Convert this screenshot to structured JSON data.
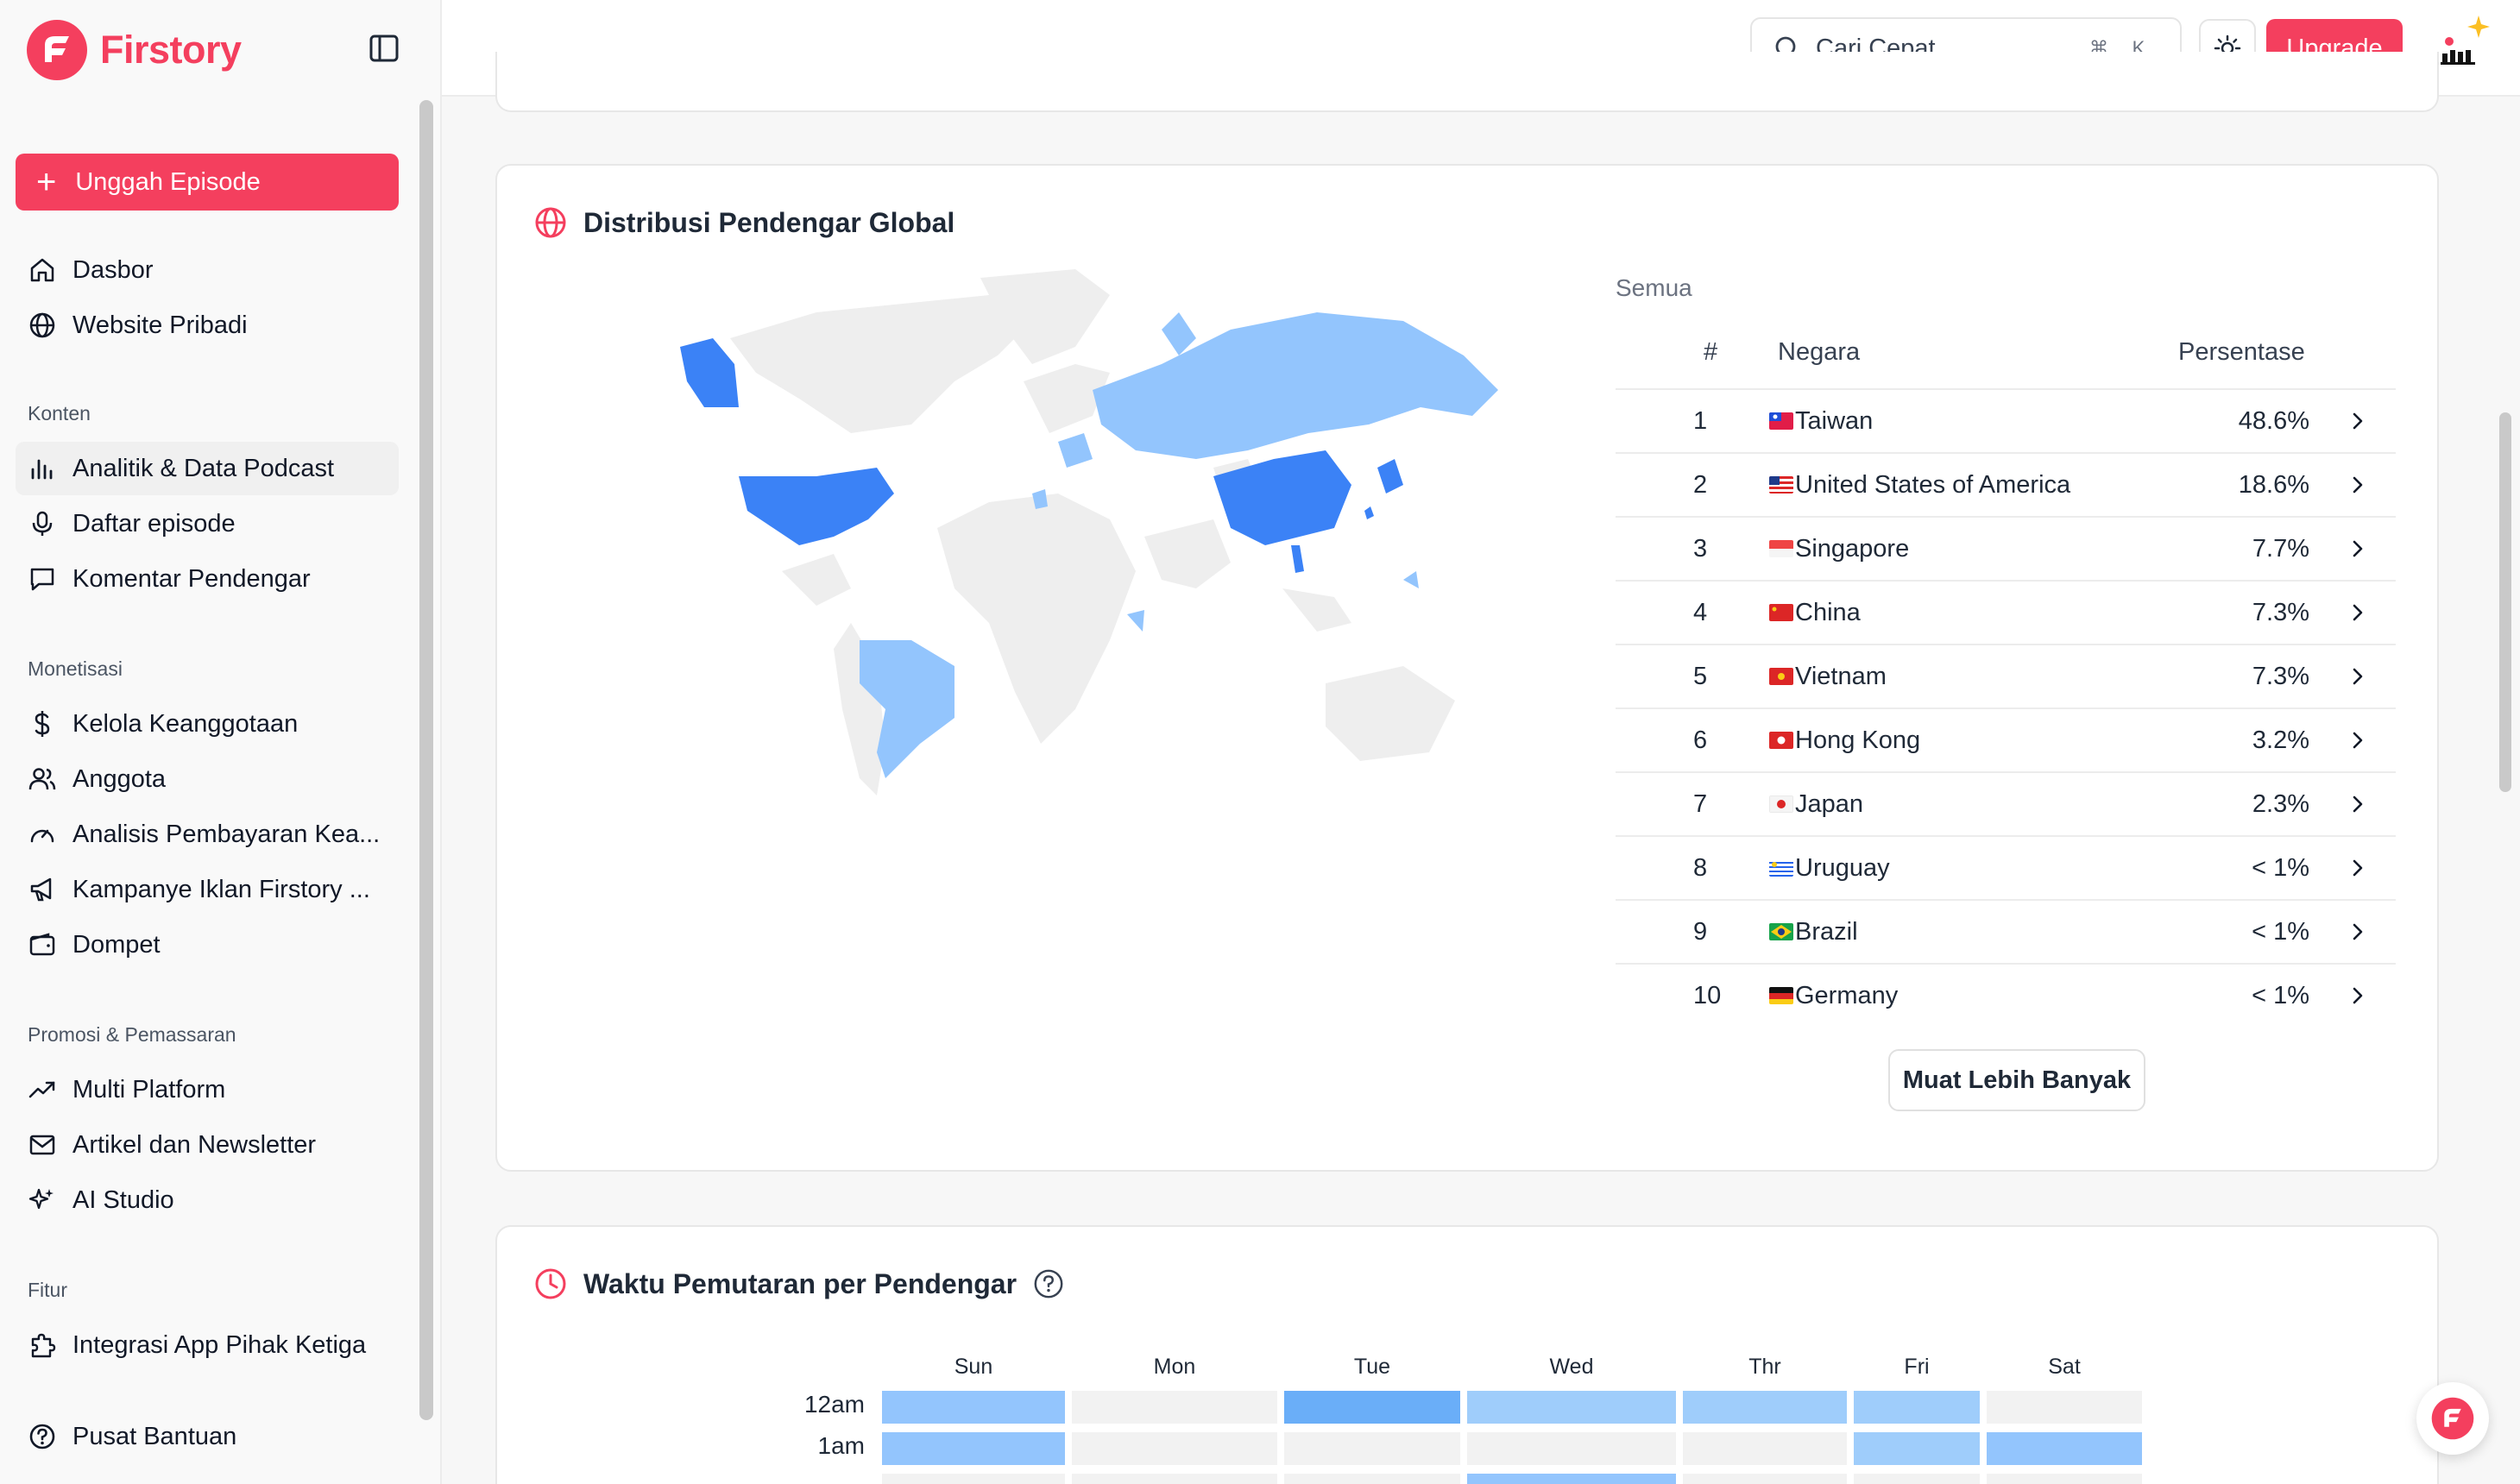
{
  "brand": {
    "name": "Firstory",
    "accent": "#f43f5e"
  },
  "sidebar": {
    "upload_label": "Unggah Episode",
    "top_items": [
      {
        "label": "Dasbor",
        "icon": "home-icon"
      },
      {
        "label": "Website Pribadi",
        "icon": "globe-icon"
      }
    ],
    "sections": [
      {
        "title": "Konten",
        "items": [
          {
            "label": "Analitik & Data Podcast",
            "icon": "bar-chart-icon",
            "active": true
          },
          {
            "label": "Daftar episode",
            "icon": "microphone-icon"
          },
          {
            "label": "Komentar Pendengar",
            "icon": "comment-icon"
          }
        ]
      },
      {
        "title": "Monetisasi",
        "items": [
          {
            "label": "Kelola Keanggotaan",
            "icon": "dollar-icon"
          },
          {
            "label": "Anggota",
            "icon": "users-icon"
          },
          {
            "label": "Analisis Pembayaran Kea...",
            "icon": "gauge-icon"
          },
          {
            "label": "Kampanye Iklan Firstory ...",
            "icon": "megaphone-icon"
          },
          {
            "label": "Dompet",
            "icon": "wallet-icon"
          }
        ]
      },
      {
        "title": "Promosi & Pemassaran",
        "items": [
          {
            "label": "Multi Platform",
            "icon": "trending-icon"
          },
          {
            "label": "Artikel dan Newsletter",
            "icon": "mail-icon"
          },
          {
            "label": "AI Studio",
            "icon": "sparkles-icon"
          }
        ]
      },
      {
        "title": "Fitur",
        "items": [
          {
            "label": "Integrasi App Pihak Ketiga",
            "icon": "puzzle-icon"
          }
        ]
      }
    ],
    "help_label": "Pusat Bantuan"
  },
  "topbar": {
    "search_placeholder": "Cari Cepat...",
    "shortcut_cmd": "⌘",
    "shortcut_key": "K",
    "upgrade_label": "Upgrade"
  },
  "distribution": {
    "title": "Distribusi Pendengar Global",
    "filter_label": "Semua",
    "columns": {
      "rank": "#",
      "country": "Negara",
      "percent": "Persentase"
    },
    "rows": [
      {
        "rank": "1",
        "country": "Taiwan",
        "percent": "48.6%",
        "flag": "flag-taiwan-icon"
      },
      {
        "rank": "2",
        "country": "United States of America",
        "percent": "18.6%",
        "flag": "flag-usa-icon"
      },
      {
        "rank": "3",
        "country": "Singapore",
        "percent": "7.7%",
        "flag": "flag-singapore-icon"
      },
      {
        "rank": "4",
        "country": "China",
        "percent": "7.3%",
        "flag": "flag-china-icon"
      },
      {
        "rank": "5",
        "country": "Vietnam",
        "percent": "7.3%",
        "flag": "flag-vietnam-icon"
      },
      {
        "rank": "6",
        "country": "Hong Kong",
        "percent": "3.2%",
        "flag": "flag-hong-kong-icon"
      },
      {
        "rank": "7",
        "country": "Japan",
        "percent": "2.3%",
        "flag": "flag-japan-icon"
      },
      {
        "rank": "8",
        "country": "Uruguay",
        "percent": "< 1%",
        "flag": "flag-uruguay-icon"
      },
      {
        "rank": "9",
        "country": "Brazil",
        "percent": "< 1%",
        "flag": "flag-brazil-icon"
      },
      {
        "rank": "10",
        "country": "Germany",
        "percent": "< 1%",
        "flag": "flag-germany-icon"
      }
    ],
    "load_more_label": "Muat Lebih Banyak",
    "map_colors": {
      "high": "#3b82f6",
      "low": "#93c5fd",
      "none": "#eeeeee"
    }
  },
  "playtime": {
    "title": "Waktu Pemutaran per Pendengar",
    "days": [
      "Sun",
      "Mon",
      "Tue",
      "Wed",
      "Thr",
      "Fri",
      "Sat"
    ],
    "hours": [
      "12am",
      "1am"
    ],
    "intensity": [
      [
        2,
        0,
        3,
        1,
        1,
        1,
        0
      ],
      [
        2,
        0,
        0,
        0,
        0,
        1,
        2
      ]
    ],
    "colors": [
      "#f2f2f2",
      "#9fcdfb",
      "#93c5fd",
      "#6aaef8"
    ]
  }
}
